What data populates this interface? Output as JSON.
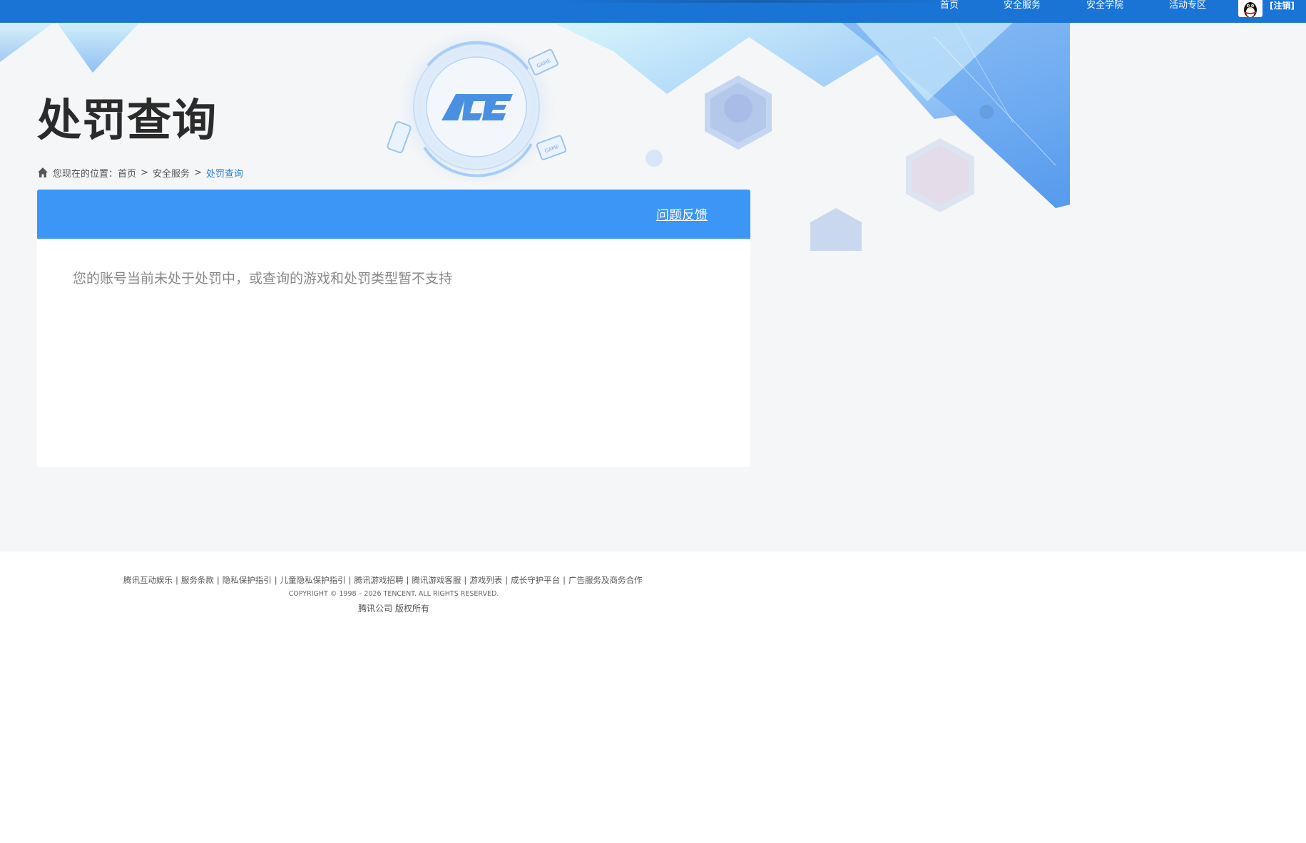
{
  "nav": {
    "items": [
      {
        "label": "首页"
      },
      {
        "label": "安全服务"
      },
      {
        "label": "安全学院"
      },
      {
        "label": "活动专区"
      }
    ],
    "logout_label": "[注销]"
  },
  "header": {
    "title": "处罚查询",
    "ace_logo_text": "ACE",
    "game_badge_text": "GAME"
  },
  "breadcrumb": {
    "prefix": "您现在的位置：",
    "items": [
      {
        "label": "首页"
      },
      {
        "label": "安全服务"
      }
    ],
    "current": "处罚查询",
    "separator": ">"
  },
  "panel": {
    "feedback_label": "问题反馈",
    "message": "您的账号当前未处于处罚中，或查询的游戏和处罚类型暂不支持"
  },
  "footer": {
    "links": [
      {
        "label": "腾讯互动娱乐"
      },
      {
        "label": "服务条款"
      },
      {
        "label": "隐私保护指引"
      },
      {
        "label": "儿童隐私保护指引"
      },
      {
        "label": "腾讯游戏招聘"
      },
      {
        "label": "腾讯游戏客服"
      },
      {
        "label": "游戏列表"
      },
      {
        "label": "成长守护平台"
      },
      {
        "label": "广告服务及商务合作"
      }
    ],
    "link_separator": "|",
    "copyright": "COPYRIGHT © 1998 – 2026 TENCENT. ALL RIGHTS RESERVED.",
    "rights": "腾讯公司 版权所有"
  },
  "colors": {
    "topbar": "#1a74d6",
    "panel_header": "#3b96f6",
    "breadcrumb_current": "#2a7fd6",
    "page_bg": "#f5f6f7"
  },
  "icons": {
    "home": "home-icon",
    "avatar": "qq-penguin-icon"
  }
}
